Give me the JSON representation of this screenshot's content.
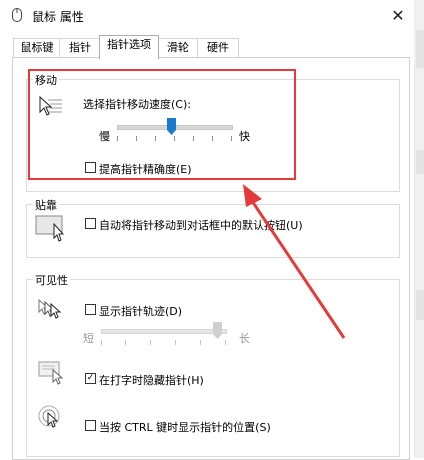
{
  "window": {
    "title": "鼠标 属性",
    "close_glyph": "✕"
  },
  "tabs": [
    {
      "label": "鼠标键",
      "active": false
    },
    {
      "label": "指针",
      "active": false
    },
    {
      "label": "指针选项",
      "active": true
    },
    {
      "label": "滑轮",
      "active": false
    },
    {
      "label": "硬件",
      "active": false
    }
  ],
  "motion": {
    "group_label": "移动",
    "speed_label": "选择指针移动速度(C):",
    "slow_label": "慢",
    "fast_label": "快",
    "speed_value_percent": 50,
    "precision_label": "提高指针精确度(E)",
    "precision_checked": false
  },
  "snap": {
    "group_label": "贴靠",
    "auto_snap_label": "自动将指针移动到对话框中的默认按钮(U)",
    "auto_snap_checked": false
  },
  "visibility": {
    "group_label": "可见性",
    "trails_label": "显示指针轨迹(D)",
    "trails_checked": false,
    "short_label": "短",
    "long_label": "长",
    "trails_value_percent": 100,
    "hide_typing_label": "在打字时隐藏指针(H)",
    "hide_typing_checked": true,
    "ctrl_label": "当按 CTRL 键时显示指针的位置(S)",
    "ctrl_checked": false
  },
  "annotation": {
    "color": "#e23b3b"
  },
  "colors": {
    "slider_thumb": "#1979ca",
    "panel_border": "#d0d0d0"
  }
}
